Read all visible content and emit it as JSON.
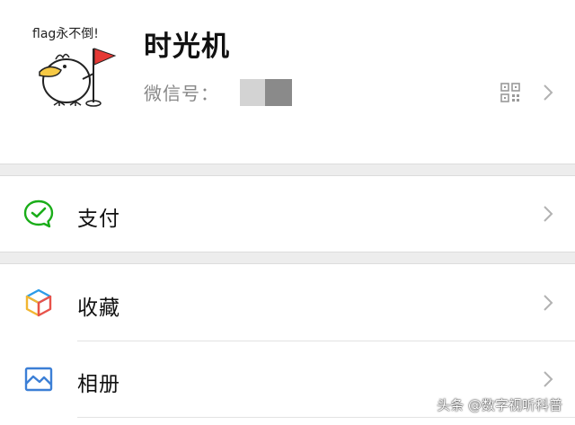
{
  "profile": {
    "name": "时光机",
    "wechat_id_label": "微信号：",
    "avatar_caption": "flag永不倒!"
  },
  "menu": {
    "pay": {
      "label": "支付",
      "icon": "wechat-pay-icon"
    },
    "favorites": {
      "label": "收藏",
      "icon": "cube-icon"
    },
    "album": {
      "label": "相册",
      "icon": "picture-icon"
    }
  },
  "watermark": "头条 @数字视听科普",
  "colors": {
    "pay_green": "#1aad19",
    "album_blue": "#3c7fd6",
    "background": "#ededed"
  }
}
